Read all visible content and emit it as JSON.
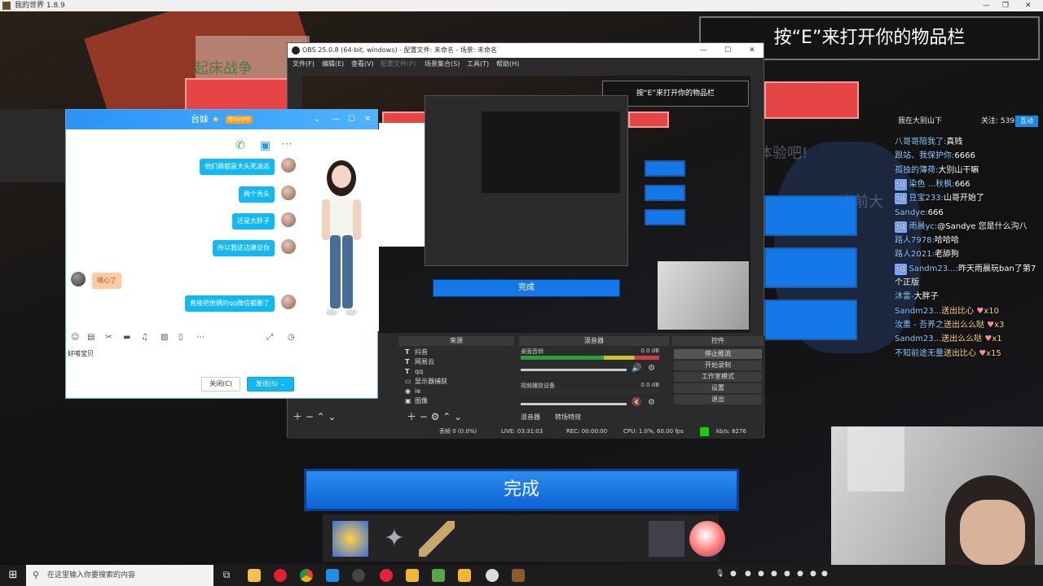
{
  "minecraft": {
    "title": "我的世界 1.8.9",
    "tip": "按“E”来打开你的物品栏",
    "done_label": "完成",
    "bg_text_1": "起床战争",
    "bg_text_2": "体验吧!",
    "bg_text_3": "当前大"
  },
  "live": {
    "streamer": "我在大别山下",
    "fans_label": "关注: 539846",
    "follow_label": "互动",
    "chat": [
      {
        "user": "八哥哥陪我了:",
        "text": "真贱"
      },
      {
        "user": "跟站、我保护你:",
        "text": "6666"
      },
      {
        "user": "孤独的薄荷:",
        "text": "大别山干嘛"
      },
      {
        "user": "染色 ...秋枫:",
        "text": "666",
        "badge": "5级"
      },
      {
        "user": "豆宝233:",
        "text": "山哥开始了",
        "badge": "5级"
      },
      {
        "user": "Sandye:",
        "text": "666"
      },
      {
        "user": "雨晨yc:",
        "text": "@Sandye 您是什么沟八",
        "badge": "5级"
      },
      {
        "user": "路人7978:",
        "text": "哈哈哈"
      },
      {
        "user": "路人2021:",
        "text": "老舔狗"
      },
      {
        "user": "Sandm23...:",
        "text": "昨天雨晨玩ban了第7",
        "badge": "5级"
      },
      {
        "user": "",
        "text": "个正版"
      },
      {
        "user": "沐雷-",
        "text": "大胖子"
      },
      {
        "user": "Sandm23...",
        "text": "送出比心",
        "gift": "x10"
      },
      {
        "user": "汝重 - 吾养之",
        "text": "送出么么哒",
        "gift": "x3"
      },
      {
        "user": "Sandm23...",
        "text": "送出么么哒",
        "gift": "x1"
      },
      {
        "user": "不知前途无量",
        "text": "送出比心",
        "gift": "x15"
      }
    ]
  },
  "obs": {
    "title": "OBS 25.0.8 (64-bit, windows) - 配置文件: 未命名 - 场景: 未命名",
    "menu": [
      "文件(F)",
      "编辑(E)",
      "查看(V)",
      "配置文件(P)",
      "场景集合(S)",
      "工具(T)",
      "帮助(H)"
    ],
    "preview_done": "完成",
    "preview_tip": "按“E”来打开你的物品栏",
    "docks": {
      "sources": "来源",
      "mixer": "混音器",
      "controls": "控件"
    },
    "sources": [
      "抖音",
      "网易云",
      "qq",
      "显示器捕获",
      "ie",
      "图像"
    ],
    "mixer_tracks": [
      {
        "name": "桌面音频",
        "db": "0.0 dB"
      },
      {
        "name": "视频播放设备",
        "db": "0.0 dB"
      }
    ],
    "mixer_tabs": [
      "混音器",
      "转场特效"
    ],
    "controls": [
      "停止推流",
      "开始录制",
      "工作室模式",
      "设置",
      "退出"
    ],
    "status": {
      "dropped": "丢帧 0 (0.0%)",
      "live": "LIVE: 03:31:03",
      "rec": "REC: 00:00:00",
      "cpu": "CPU: 1.0%, 60.00 fps",
      "kbps": "kb/s: 8276"
    }
  },
  "qq": {
    "contact": "台妹",
    "vip": "年SVIP6",
    "messages": [
      {
        "side": "right",
        "text": "他们俩都是大头死凌态"
      },
      {
        "side": "right",
        "text": "两个秃头"
      },
      {
        "side": "right",
        "text": "还是大胖子"
      },
      {
        "side": "right",
        "text": "所以我这边建议你"
      },
      {
        "side": "left",
        "text": "嗯心了"
      },
      {
        "side": "right",
        "text": "直接把他俩的qq微信都删了"
      }
    ],
    "input_text": "好嗒宝贝",
    "close_label": "关闭(C)",
    "send_label": "发送(S)"
  },
  "taskbar": {
    "search_placeholder": "在这里输入你要搜索的内容"
  },
  "colors": {
    "qq_blue": "#12b7f5",
    "mc_blue": "#1478e8",
    "mc_red": "#e64545",
    "obs_bg": "#2b2b2b"
  }
}
